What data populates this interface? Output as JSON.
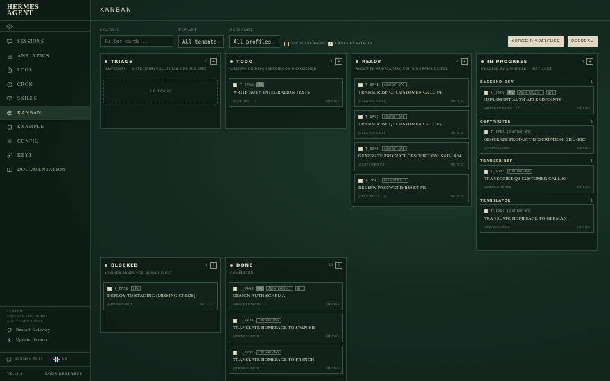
{
  "brand": {
    "line1": "HERMES",
    "line2": "AGENT"
  },
  "nav": [
    {
      "label": "SESSIONS",
      "icon": "chat-icon"
    },
    {
      "label": "ANALYTICS",
      "icon": "chart-icon"
    },
    {
      "label": "LOGS",
      "icon": "file-icon"
    },
    {
      "label": "CRON",
      "icon": "clock-icon"
    },
    {
      "label": "SKILLS",
      "icon": "package-icon"
    },
    {
      "label": "KANBAN",
      "icon": "kanban-icon",
      "active": true
    },
    {
      "label": "EXAMPLE",
      "icon": "puzzle-icon"
    },
    {
      "label": "CONFIG",
      "icon": "gear-icon"
    },
    {
      "label": "KEYS",
      "icon": "key-icon"
    },
    {
      "label": "DOCUMENTATION",
      "icon": "book-icon"
    }
  ],
  "system": {
    "title": "SYSTEM",
    "gateway_label": "GATEWAY STATUS",
    "gateway_value": "OFF",
    "sessions_label": "ACTIVE SESSIONS",
    "sessions_value": "0",
    "restart_label": "Restart Gateway",
    "update_label": "Update Hermes"
  },
  "footer": {
    "theme": "HERMES TEAL",
    "lang": "EN",
    "version": "V0.11.0",
    "org": "NOUS RESEARCH"
  },
  "header": {
    "title": "KANBAN"
  },
  "filters": {
    "search_label": "SEARCH",
    "search_placeholder": "Filter cards...",
    "tenant_label": "TENANT",
    "tenant_value": "All tenants",
    "assignee_label": "ASSIGNEE",
    "assignee_value": "All profiles",
    "show_archived": "SHOW ARCHIVED",
    "lanes_by_profile": "LANES BY PROFILE",
    "nudge": "NUDGE DISPATCHER",
    "refresh": "REFRESH"
  },
  "columns": {
    "triage": {
      "title": "TRIAGE",
      "count": "0",
      "desc": "RAW IDEAS — A SPECIFIER WILL FLESH OUT THE SPEC",
      "empty": "— NO TASKS —"
    },
    "todo": {
      "title": "TODO",
      "count": "1",
      "desc": "WAITING ON DEPENDENCIES OR UNASSIGNED",
      "cards": [
        {
          "id": "T_6F5A",
          "tags": [
            "P2"
          ],
          "title": "WRITE AUTH INTEGRATION TESTS",
          "assignee": "@QA-DEV  ·  ↑1",
          "age": "3M AGO"
        }
      ]
    },
    "ready": {
      "title": "READY",
      "count": "4",
      "desc": "ASSIGNED AND WAITING FOR A DISPATCHER TICK",
      "cards": [
        {
          "id": "T_6F4E",
          "tags": [
            "CONTENT-OPS"
          ],
          "title": "TRANSCRIBE Q3 CUSTOMER CALL #4",
          "assignee": "@TRANSCRIBER",
          "age": "3M AGO"
        },
        {
          "id": "T_8A73",
          "tags": [
            "CONTENT-OPS"
          ],
          "title": "TRANSCRIBE Q3 CUSTOMER CALL #5",
          "assignee": "@TRANSCRIBER",
          "age": "3M AGO"
        },
        {
          "id": "T_0040",
          "tags": [
            "CONTENT-OPS"
          ],
          "title": "GENERATE PRODUCT DESCRIPTION: SKU-1004",
          "assignee": "@COPYWRITER",
          "age": "3M AGO"
        },
        {
          "id": "T_28A3",
          "tags": [
            "AUTH-PROJECT"
          ],
          "title": "REVIEW PASSWORD RESET PR",
          "assignee": "@REVIEWER  ·  ↑1",
          "age": "3M AGO"
        }
      ]
    },
    "inprogress": {
      "title": "IN PROGRESS",
      "count": "4",
      "desc": "CLAIMED BY A WORKER — IN-FLIGHT",
      "lanes": [
        {
          "name": "BACKEND-DEV",
          "count": "1",
          "cards": [
            {
              "id": "T_23F6",
              "tags": [
                "P1",
                "AUTH-PROJECT",
                "0/1"
              ],
              "title": "IMPLEMENT AUTH API ENDPOINTS",
              "assignee": "@BACKEND-DEV  ·  ↑2",
              "age": "3M AGO"
            }
          ]
        },
        {
          "name": "COPYWRITER",
          "count": "1",
          "cards": [
            {
              "id": "T_045A",
              "tags": [
                "CONTENT-OPS"
              ],
              "title": "GENERATE PRODUCT DESCRIPTION: SKU-1003",
              "assignee": "@COPYWRITER",
              "age": "3M AGO"
            }
          ]
        },
        {
          "name": "TRANSCRIBER",
          "count": "1",
          "cards": [
            {
              "id": "T_9D3F",
              "tags": [
                "CONTENT-OPS"
              ],
              "title": "TRANSCRIBE Q3 CUSTOMER CALL #3",
              "assignee": "@TRANSCRIBER",
              "age": "3M AGO"
            }
          ]
        },
        {
          "name": "TRANSLATOR",
          "count": "1",
          "cards": [
            {
              "id": "T_B21C",
              "tags": [
                "CONTENT-OPS"
              ],
              "title": "TRANSLATE HOMEPAGE TO GERMAN",
              "assignee": "@TRANSLATOR",
              "age": "3M AGO"
            }
          ]
        }
      ]
    },
    "blocked": {
      "title": "BLOCKED",
      "count": "1",
      "desc": "WORKER ASKED FOR HUMAN INPUT",
      "cards": [
        {
          "id": "T_EF5D",
          "tags": [
            "OPS"
          ],
          "title": "DEPLOY TO STAGING (MISSING CREDS)",
          "assignee": "@DEPLOY-BOT",
          "age": "3M AGO"
        }
      ]
    },
    "done": {
      "title": "DONE",
      "count": "10",
      "desc": "COMPLETED",
      "cards": [
        {
          "id": "T_0460",
          "tags": [
            "P1",
            "AUTH-PROJECT",
            "0/1"
          ],
          "title": "DESIGN AUTH SCHEMA",
          "assignee": "@BACKEND-DEV  ·  ↑1",
          "age": "3M AGO"
        },
        {
          "id": "T_5A39",
          "tags": [
            "CONTENT-OPS"
          ],
          "title": "TRANSLATE HOMEPAGE TO SPANISH",
          "assignee": "@TRANSLATOR",
          "age": "3M AGO"
        },
        {
          "id": "T_279E",
          "tags": [
            "CONTENT-OPS"
          ],
          "title": "TRANSLATE HOMEPAGE TO FRENCH",
          "assignee": "@TRANSLATOR",
          "age": "3M AGO"
        }
      ]
    }
  }
}
